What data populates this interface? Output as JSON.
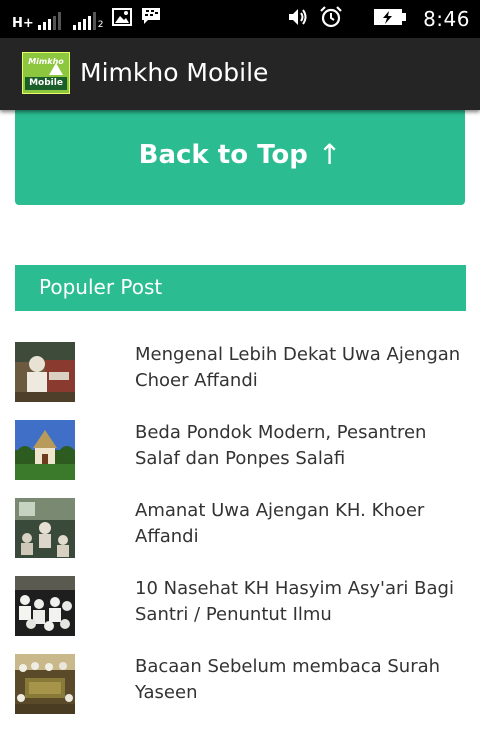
{
  "status_bar": {
    "network_type": "H+",
    "sim_number": "2",
    "time": "8:46"
  },
  "app_bar": {
    "logo_top_text": "Mimkho",
    "logo_bottom_text": "Mobile",
    "title": "Mimkho Mobile"
  },
  "back_to_top": {
    "label": "Back to Top",
    "arrow": "↑"
  },
  "popular": {
    "heading": "Populer Post",
    "posts": [
      {
        "title": "Mengenal Lebih Dekat Uwa Ajengan Choer Affandi"
      },
      {
        "title": "Beda Pondok Modern, Pesantren Salaf dan Ponpes Salafi"
      },
      {
        "title": "Amanat Uwa Ajengan KH. Khoer Affandi"
      },
      {
        "title": "10 Nasehat KH Hasyim Asy'ari Bagi Santri / Penuntut Ilmu"
      },
      {
        "title": "Bacaan Sebelum membaca Surah Yaseen"
      }
    ]
  },
  "colors": {
    "accent": "#2bbd91",
    "app_bar": "#252525",
    "status_bar": "#000000"
  },
  "icons": [
    "signal-icon",
    "signal-sim2-icon",
    "image-notification-icon",
    "bbm-notification-icon",
    "volume-icon",
    "alarm-icon",
    "battery-charging-icon"
  ]
}
